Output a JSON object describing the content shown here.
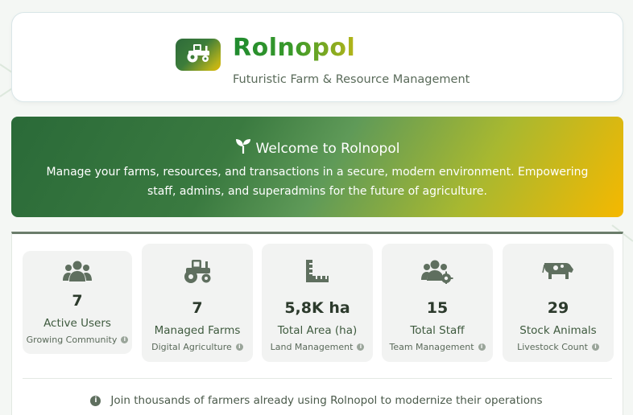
{
  "header": {
    "brand_title": "Rolnopol",
    "brand_subtitle": "Futuristic Farm & Resource Management",
    "logo_icon": "tractor-icon"
  },
  "welcome": {
    "icon": "seedling-icon",
    "title": "Welcome to Rolnopol",
    "text": "Manage your farms, resources, and transactions in a secure, modern environment. Empowering staff, admins, and superadmins for the future of agriculture."
  },
  "stats": [
    {
      "icon": "users-icon",
      "value": "7",
      "label": "Active Users",
      "sub": "Growing Community"
    },
    {
      "icon": "tractor-icon",
      "value": "7",
      "label": "Managed Farms",
      "sub": "Digital Agriculture"
    },
    {
      "icon": "ruler-icon",
      "value": "5,8K ha",
      "label": "Total Area (ha)",
      "sub": "Land Management"
    },
    {
      "icon": "users-gear-icon",
      "value": "15",
      "label": "Total Staff",
      "sub": "Team Management"
    },
    {
      "icon": "cow-icon",
      "value": "29",
      "label": "Stock Animals",
      "sub": "Livestock Count"
    }
  ],
  "footer": {
    "icon": "info-icon",
    "text": "Join thousands of farmers already using Rolnopol to modernize their operations"
  },
  "colors": {
    "brand_green": "#1f8a2e",
    "accent_gold": "#f5b800",
    "icon_gray": "#5f6f5f"
  }
}
